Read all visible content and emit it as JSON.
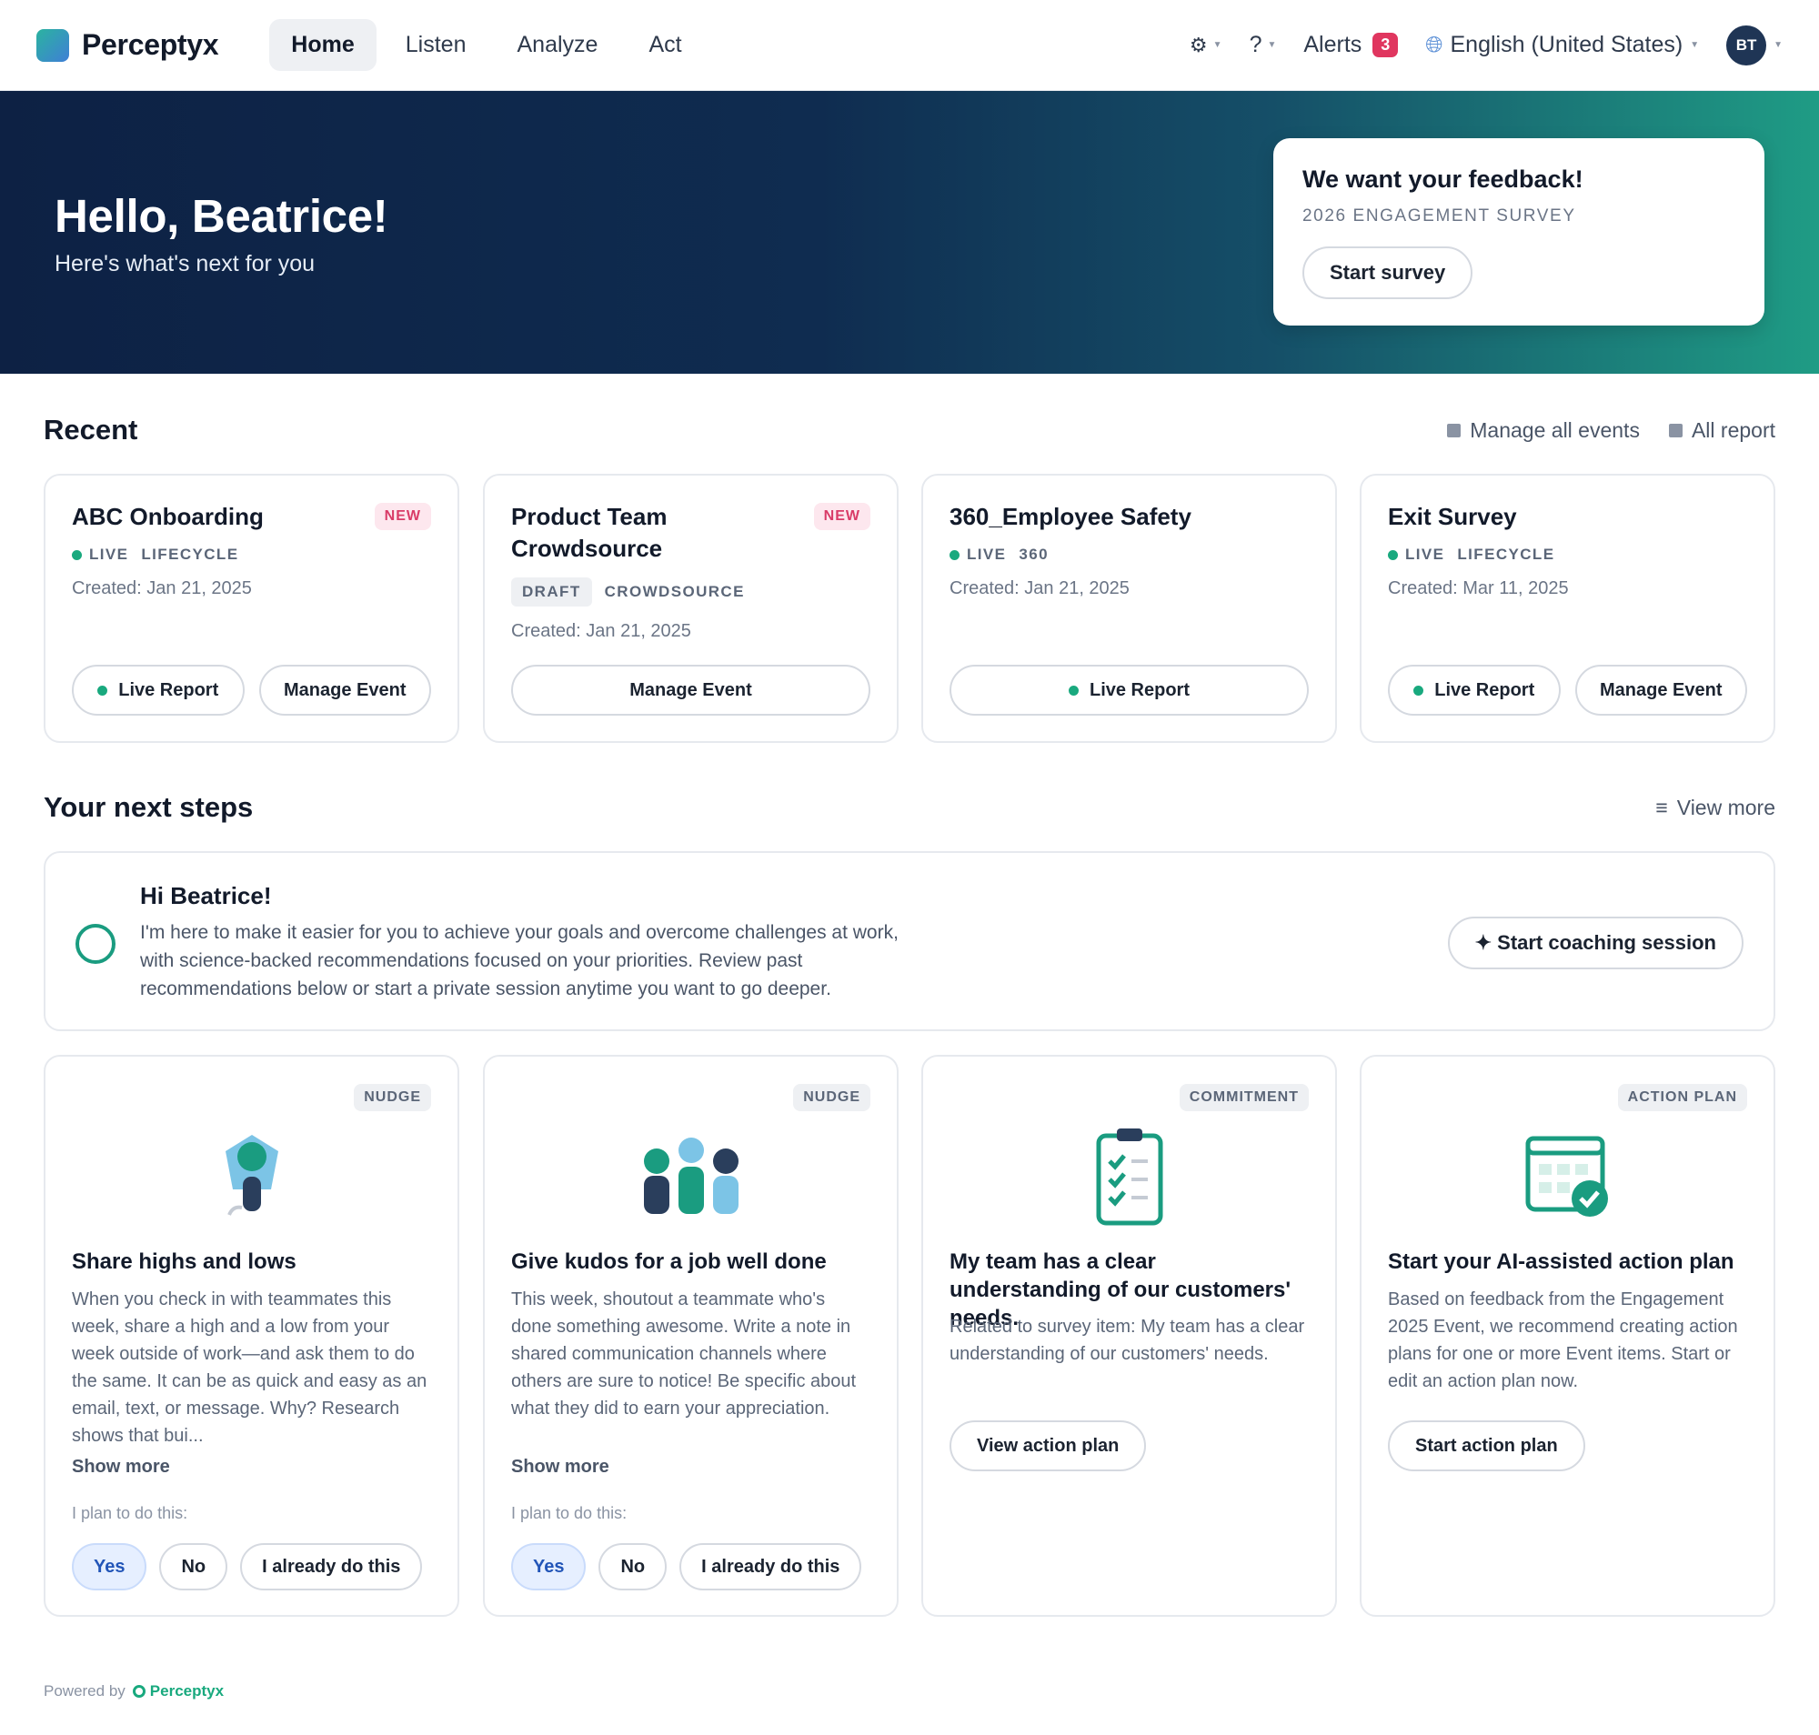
{
  "nav": {
    "brand": "Perceptyx",
    "links": [
      "Home",
      "Listen",
      "Analyze",
      "Act"
    ],
    "settings_icon": "⚙",
    "help_icon": "?",
    "alerts_label": "Alerts",
    "alerts_count": "3",
    "language": "English (United States)",
    "avatar_initials": "BT"
  },
  "hero": {
    "greeting": "Hello, Beatrice!",
    "subtitle": "Here's what's next for you",
    "feedback": {
      "title": "We want your feedback!",
      "survey_name": "2026 ENGAGEMENT SURVEY",
      "button": "Start survey"
    }
  },
  "recent": {
    "title": "Recent",
    "links": [
      "Manage all events",
      "All report"
    ],
    "cards": [
      {
        "title": "ABC Onboarding",
        "badge": "NEW",
        "status": "LIVE",
        "type": "LIFECYCLE",
        "created": "Created: Jan 21, 2025",
        "buttons": [
          "Live Report",
          "Manage Event"
        ]
      },
      {
        "title": "Product Team Crowdsource",
        "badge": "NEW",
        "status": "DRAFT",
        "type": "CROWDSOURCE",
        "created": "Created: Jan 21, 2025",
        "buttons": [
          "Manage Event"
        ]
      },
      {
        "title": "360_Employee Safety",
        "badge": "",
        "status": "LIVE",
        "type": "360",
        "created": "Created: Jan 21, 2025",
        "buttons": [
          "Live Report"
        ]
      },
      {
        "title": "Exit Survey",
        "badge": "",
        "status": "LIVE",
        "type": "LIFECYCLE",
        "created": "Created: Mar 11, 2025",
        "buttons": [
          "Live Report",
          "Manage Event"
        ]
      }
    ]
  },
  "next_steps": {
    "title": "Your next steps",
    "view_more": "View more",
    "coach": {
      "title": "Hi Beatrice!",
      "body": "I'm here to make it easier for you to achieve your goals and overcome challenges at work, with science-backed recommendations focused on your priorities. Review past recommendations below or start a private session anytime you want to go deeper.",
      "button": "✦ Start coaching session"
    },
    "cards": [
      {
        "badge": "NUDGE",
        "title": "Share highs and lows",
        "body": "When you check in with teammates this week, share a high and a low from your week outside of work—and ask them to do the same. It can be as quick and easy as an email, text, or message. Why? Research shows that bui...",
        "show_more": "Show more",
        "plan_label": "I plan to do this:",
        "options": [
          "Yes",
          "No",
          "I already do this"
        ]
      },
      {
        "badge": "NUDGE",
        "title": "Give kudos for a job well done",
        "body": "This week, shoutout a teammate who's done something awesome. Write a note in shared communication channels where others are sure to notice! Be specific about what they did to earn your appreciation.",
        "show_more": "Show more",
        "plan_label": "I plan to do this:",
        "options": [
          "Yes",
          "No",
          "I already do this"
        ]
      },
      {
        "badge": "COMMITMENT",
        "title": "My team has a clear understanding of our customers' needs.",
        "body": "Related to survey item: My team has a clear understanding of our customers' needs.",
        "button": "View action plan"
      },
      {
        "badge": "ACTION PLAN",
        "title": "Start your AI-assisted action plan",
        "body": "Based on feedback from the Engagement 2025 Event, we recommend creating action plans for one or more Event items. Start or edit an action plan now.",
        "button": "Start action plan"
      }
    ]
  },
  "footer": {
    "powered_by": "Powered by",
    "brand": "Perceptyx"
  },
  "colors": {
    "accent_green": "#19a97e",
    "alert_red": "#e0365f",
    "navy": "#0d2144"
  }
}
